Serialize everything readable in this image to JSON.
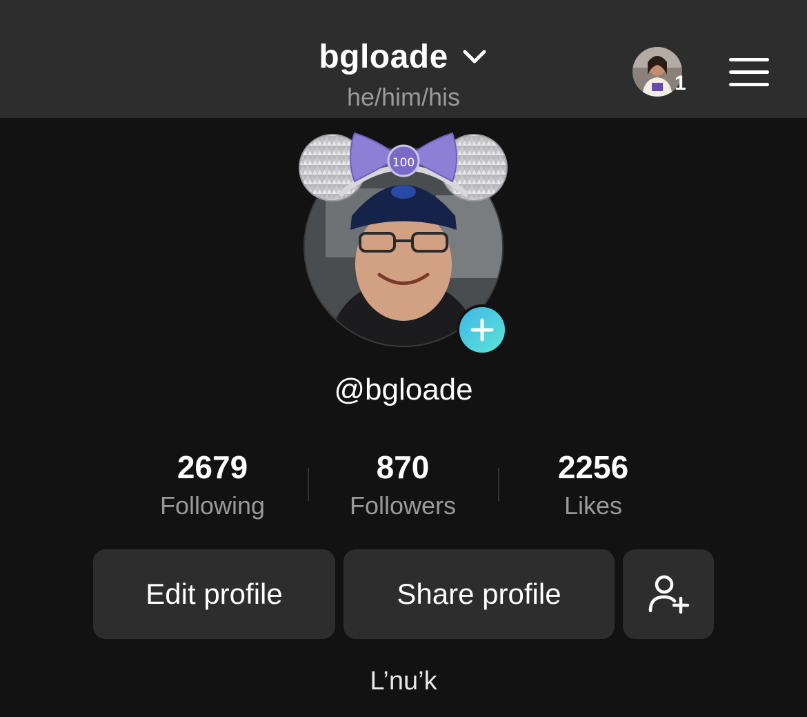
{
  "header": {
    "username": "bgloade",
    "pronouns": "he/him/his",
    "account_switch_count": "1"
  },
  "icons": {
    "chevron": "chevron-down-icon",
    "menu": "hamburger-menu-icon",
    "add_photo": "plus-icon",
    "add_friend": "add-friend-icon"
  },
  "profile": {
    "handle": "@bgloade",
    "bio": "L’nu’k"
  },
  "stats": [
    {
      "value": "2679",
      "label": "Following"
    },
    {
      "value": "870",
      "label": "Followers"
    },
    {
      "value": "2256",
      "label": "Likes"
    }
  ],
  "actions": {
    "edit_label": "Edit profile",
    "share_label": "Share profile"
  },
  "avatar_frame_badge": "100",
  "colors": {
    "background": "#121212",
    "header": "#2d2d2d",
    "button": "#2d2d2d",
    "muted_text": "#9a9a9a",
    "accent_gradient_start": "#3fb8e8",
    "accent_gradient_end": "#5ce3d6",
    "ears_bow": "#8e7fd6"
  }
}
